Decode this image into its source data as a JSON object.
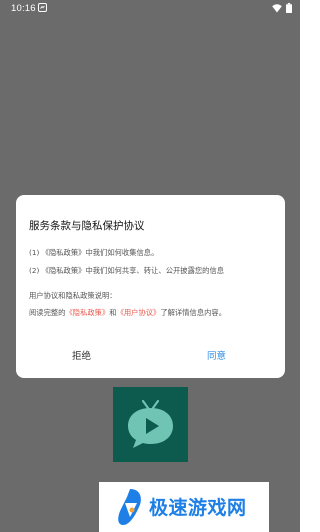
{
  "status_bar": {
    "time": "10:16",
    "icons": [
      "notification-icon",
      "wifi-icon",
      "battery-icon"
    ]
  },
  "dialog": {
    "title": "服务条款与隐私保护协议",
    "clauses": [
      {
        "prefix": "(1) ",
        "link": "《隐私政策》",
        "text": "中我们如何收集信息。"
      },
      {
        "prefix": "(2) ",
        "link": "《隐私政策》",
        "text": "中我们如何共享、转让、公开披露您的信息"
      }
    ],
    "explanation_heading": "用户协议和隐私政策说明：",
    "explanation": {
      "before": "阅读完整的",
      "privacy_link": "《隐私政策》",
      "middle": "和",
      "user_link": "《用户协议》",
      "after": "了解详情信息内容。"
    },
    "refuse_label": "拒绝",
    "agree_label": "同意"
  },
  "watermark": {
    "text": "极速游戏网"
  },
  "colors": {
    "overlay": "#6b6b6b",
    "link_red": "#e85a4f",
    "agree_blue": "#2d8ee6",
    "app_icon_bg": "#0d5a4f",
    "watermark_blue": "#1e7fe6"
  }
}
